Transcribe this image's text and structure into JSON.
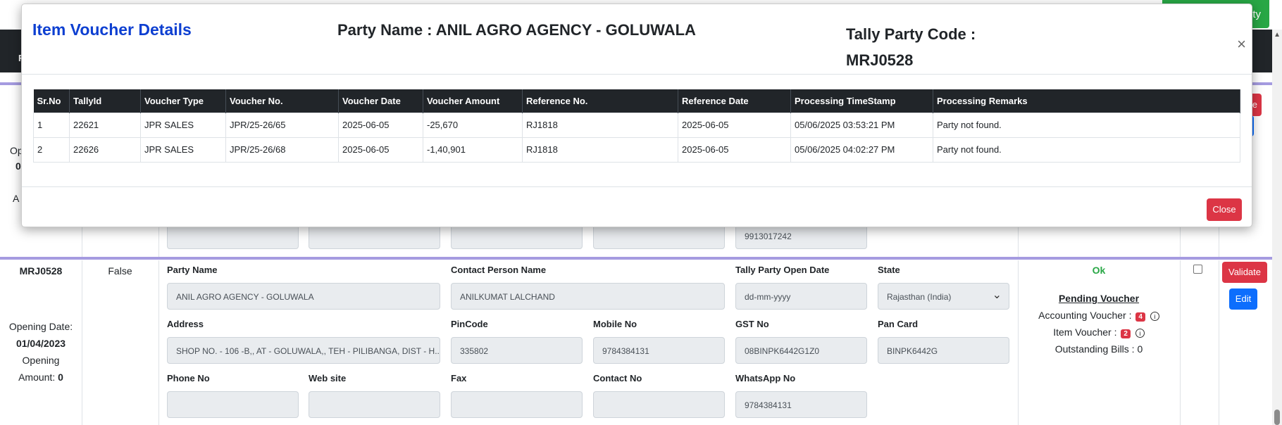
{
  "background": {
    "top_button_label": "ty",
    "nav_partial": "F",
    "row1": {
      "left_partial_1": "Op",
      "left_partial_2": "0",
      "left_partial_3": "A",
      "validate_partial": "te",
      "field_value_whatsapp": "9913017242"
    },
    "row2": {
      "code": "MRJ0528",
      "is_flag": "False",
      "opening_date_label": "Opening Date:",
      "opening_date": "01/04/2023",
      "opening_amount_label": "Opening",
      "opening_amount_label2": "Amount:",
      "opening_amount": "0",
      "fields": {
        "party_name": {
          "label": "Party Name",
          "value": "ANIL AGRO AGENCY - GOLUWALA"
        },
        "contact_person": {
          "label": "Contact Person Name",
          "value": "ANILKUMAT LALCHAND"
        },
        "tally_open_date": {
          "label": "Tally Party Open Date",
          "value": "dd-mm-yyyy"
        },
        "state": {
          "label": "State",
          "value": "Rajasthan (India)"
        },
        "address": {
          "label": "Address",
          "value": "SHOP NO. - 106 -B,, AT - GOLUWALA,, TEH - PILIBANGA, DIST - H..."
        },
        "pincode": {
          "label": "PinCode",
          "value": "335802"
        },
        "mobile": {
          "label": "Mobile No",
          "value": "9784384131"
        },
        "gst": {
          "label": "GST No",
          "value": "08BINPK6442G1Z0"
        },
        "pan": {
          "label": "Pan Card",
          "value": "BINPK6442G"
        },
        "phone": {
          "label": "Phone No",
          "value": ""
        },
        "website": {
          "label": "Web site",
          "value": ""
        },
        "fax": {
          "label": "Fax",
          "value": ""
        },
        "contact_no": {
          "label": "Contact No",
          "value": ""
        },
        "whatsapp": {
          "label": "WhatsApp No",
          "value": "9784384131"
        }
      },
      "status": "Ok",
      "pending_voucher_title": "Pending Voucher",
      "accounting_voucher_label": "Accounting Voucher :",
      "accounting_voucher_count": "4",
      "item_voucher_label": "Item Voucher :",
      "item_voucher_count": "2",
      "outstanding_bills": "Outstanding Bills : 0",
      "validate_label": "Validate",
      "edit_label": "Edit"
    }
  },
  "modal": {
    "title": "Item Voucher Details",
    "party_name": "Party Name : ANIL AGRO AGENCY - GOLUWALA",
    "tally_code_label": "Tally Party Code :",
    "tally_code": "MRJ0528",
    "close_icon": "×",
    "close_button": "Close",
    "table": {
      "headers": [
        "Sr.No",
        "TallyId",
        "Voucher Type",
        "Voucher No.",
        "Voucher Date",
        "Voucher Amount",
        "Reference No.",
        "Reference Date",
        "Processing TimeStamp",
        "Processing Remarks"
      ],
      "rows": [
        [
          "1",
          "22621",
          "JPR SALES",
          "JPR/25-26/65",
          "2025-06-05",
          "-25,670",
          "RJ1818",
          "2025-06-05",
          "05/06/2025 03:53:21 PM",
          "Party not found."
        ],
        [
          "2",
          "22626",
          "JPR SALES",
          "JPR/25-26/68",
          "2025-06-05",
          "-1,40,901",
          "RJ1818",
          "2025-06-05",
          "05/06/2025 04:02:27 PM",
          "Party not found."
        ]
      ]
    }
  },
  "colors": {
    "title_blue": "#0d3fd1",
    "table_header_bg": "#212529",
    "danger": "#dc3545",
    "primary": "#0d6efd",
    "success": "#28a745",
    "divider_purple": "#a59be0"
  }
}
